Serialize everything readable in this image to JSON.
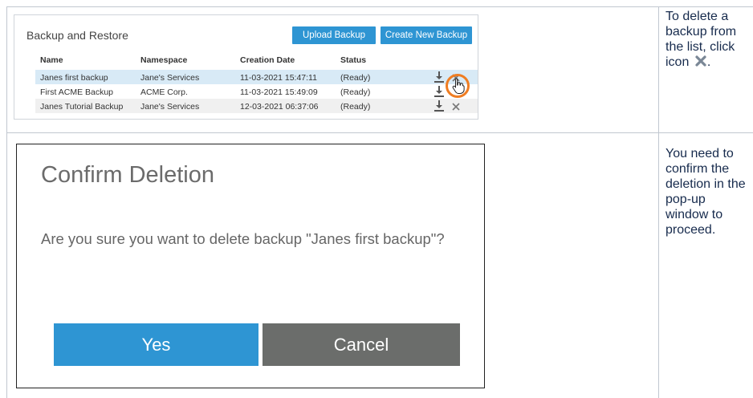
{
  "row1": {
    "screenshot": {
      "title": "Backup and Restore",
      "upload_label": "Upload Backup",
      "create_label": "Create New Backup",
      "columns": [
        "Name",
        "Namespace",
        "Creation Date",
        "Status"
      ],
      "rows": [
        {
          "name": "Janes first backup",
          "namespace": "Jane's Services",
          "date": "11-03-2021 15:47:11",
          "status": "(Ready)"
        },
        {
          "name": "First ACME Backup",
          "namespace": "ACME Corp.",
          "date": "11-03-2021 15:49:09",
          "status": "(Ready)"
        },
        {
          "name": "Janes Tutorial Backup",
          "namespace": "Jane's Services",
          "date": "12-03-2021 06:37:06",
          "status": "(Ready)"
        }
      ]
    },
    "description": {
      "text": "To delete a backup from the list, click icon",
      "suffix": "."
    }
  },
  "row2": {
    "dialog": {
      "title": "Confirm Deletion",
      "message": "Are you sure you want to delete backup \"Janes first backup\"?",
      "yes_label": "Yes",
      "cancel_label": "Cancel"
    },
    "description": {
      "text": "You need to confirm the deletion in the pop-up window to proceed."
    }
  },
  "colors": {
    "accent_blue": "#2e95d3",
    "highlight_orange": "#ef7d22",
    "cancel_gray": "#6b6d6b",
    "selected_row": "#d8eaf6"
  }
}
